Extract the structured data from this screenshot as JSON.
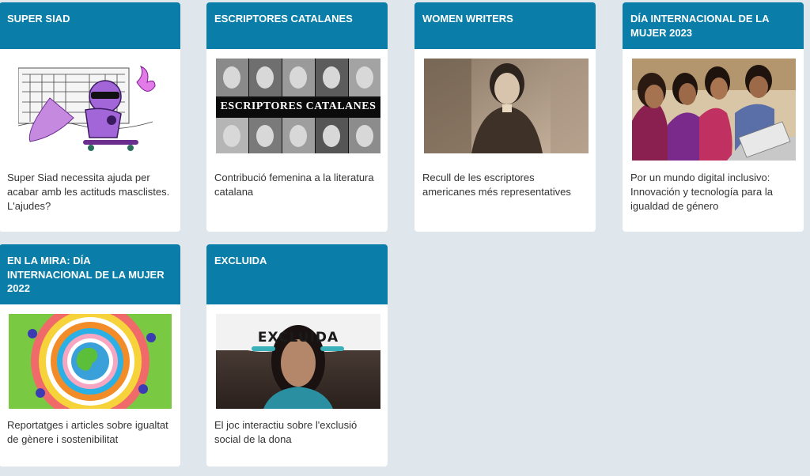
{
  "cards": [
    {
      "title": "SUPER SIAD",
      "desc": "Super Siad necessita ajuda per acabar amb les actituds masclistes. L'ajudes?"
    },
    {
      "title": "ESCRIPTORES CATALANES",
      "desc": "Contribució femenina a la literatura catalana",
      "image_caption": "ESCRIPTORES CATALANES"
    },
    {
      "title": "WOMEN WRITERS",
      "desc": "Recull de les escriptores americanes més representatives"
    },
    {
      "title": "DÍA INTERNACIONAL DE LA MUJER 2023",
      "desc": "Por un mundo digital inclusivo: Innovación y tecnología para la igualdad de género"
    },
    {
      "title": "EN LA MIRA: DÍA INTERNACIONAL DE LA MUJER 2022",
      "desc": "Reportatges i articles sobre igualtat de gènere i sostenibilitat"
    },
    {
      "title": "EXCLUIDA",
      "desc": "El joc interactiu sobre l'exclusió social de la dona",
      "image_caption": "EXCLUIDA"
    }
  ],
  "colors": {
    "header": "#0a7ea8",
    "background": "#dfe6ec",
    "card": "#ffffff"
  }
}
